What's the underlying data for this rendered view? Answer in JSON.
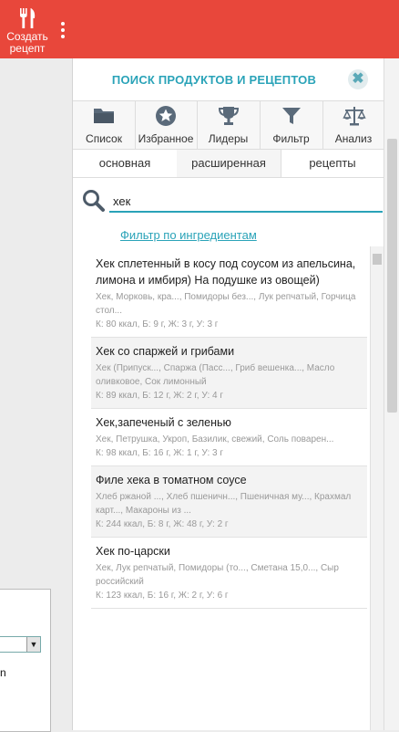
{
  "topbar": {
    "create_label": "Создать рецепт",
    "accent": "#e8473b"
  },
  "panel": {
    "title": "ПОИСК ПРОДУКТОВ И РЕЦЕПТОВ",
    "close_symbol": "✖",
    "accent": "#2aa3b8",
    "tabs": [
      {
        "icon": "folder-icon",
        "label": "Список"
      },
      {
        "icon": "star-icon",
        "label": "Избранное"
      },
      {
        "icon": "trophy-icon",
        "label": "Лидеры"
      },
      {
        "icon": "funnel-icon",
        "label": "Фильтр"
      },
      {
        "icon": "scales-icon",
        "label": "Анализ"
      }
    ],
    "subtabs": [
      "основная",
      "расширенная",
      "рецепты"
    ],
    "search": {
      "value": "хек",
      "placeholder": ""
    },
    "filter_link": "Фильтр по ингредиентам",
    "results": [
      {
        "title": "Хек сплетенный в косу под соусом из апельсина, лимона и имбиря) На подушке из овощей)",
        "ingredients": "Хек, Морковь, кра..., Помидоры без..., Лук репчатый, Горчица стол...",
        "nutrition": "К: 80 ккал, Б: 9 г, Ж: 3 г, У: 3 г"
      },
      {
        "title": "Хек со спаржей и грибами",
        "ingredients": "Хек (Припуск..., Спаржа (Пасс..., Гриб вешенка..., Масло оливковое, Сок лимонный",
        "nutrition": "К: 89 ккал, Б: 12 г, Ж: 2 г, У: 4 г"
      },
      {
        "title": "Хек,запеченый с зеленью",
        "ingredients": "Хек, Петрушка, Укроп, Базилик, свежий, Соль поварен...",
        "nutrition": "К: 98 ккал, Б: 16 г, Ж: 1 г, У: 3 г"
      },
      {
        "title": "Филе хека в томатном соусе",
        "ingredients": "Хлеб ржаной ..., Хлеб пшеничн..., Пшеничная му..., Крахмал карт..., Макароны из ...",
        "nutrition": "К: 244 ккал, Б: 8 г, Ж: 48 г, У: 2 г"
      },
      {
        "title": "Хек по-царски",
        "ingredients": "Хек, Лук репчатый, Помидоры (то..., Сметана 15,0..., Сыр российский",
        "nutrition": "К: 123 ккал, Б: 16 г, Ж: 2 г, У: 6 г"
      }
    ]
  },
  "left": {
    "fragment_text": "n"
  }
}
